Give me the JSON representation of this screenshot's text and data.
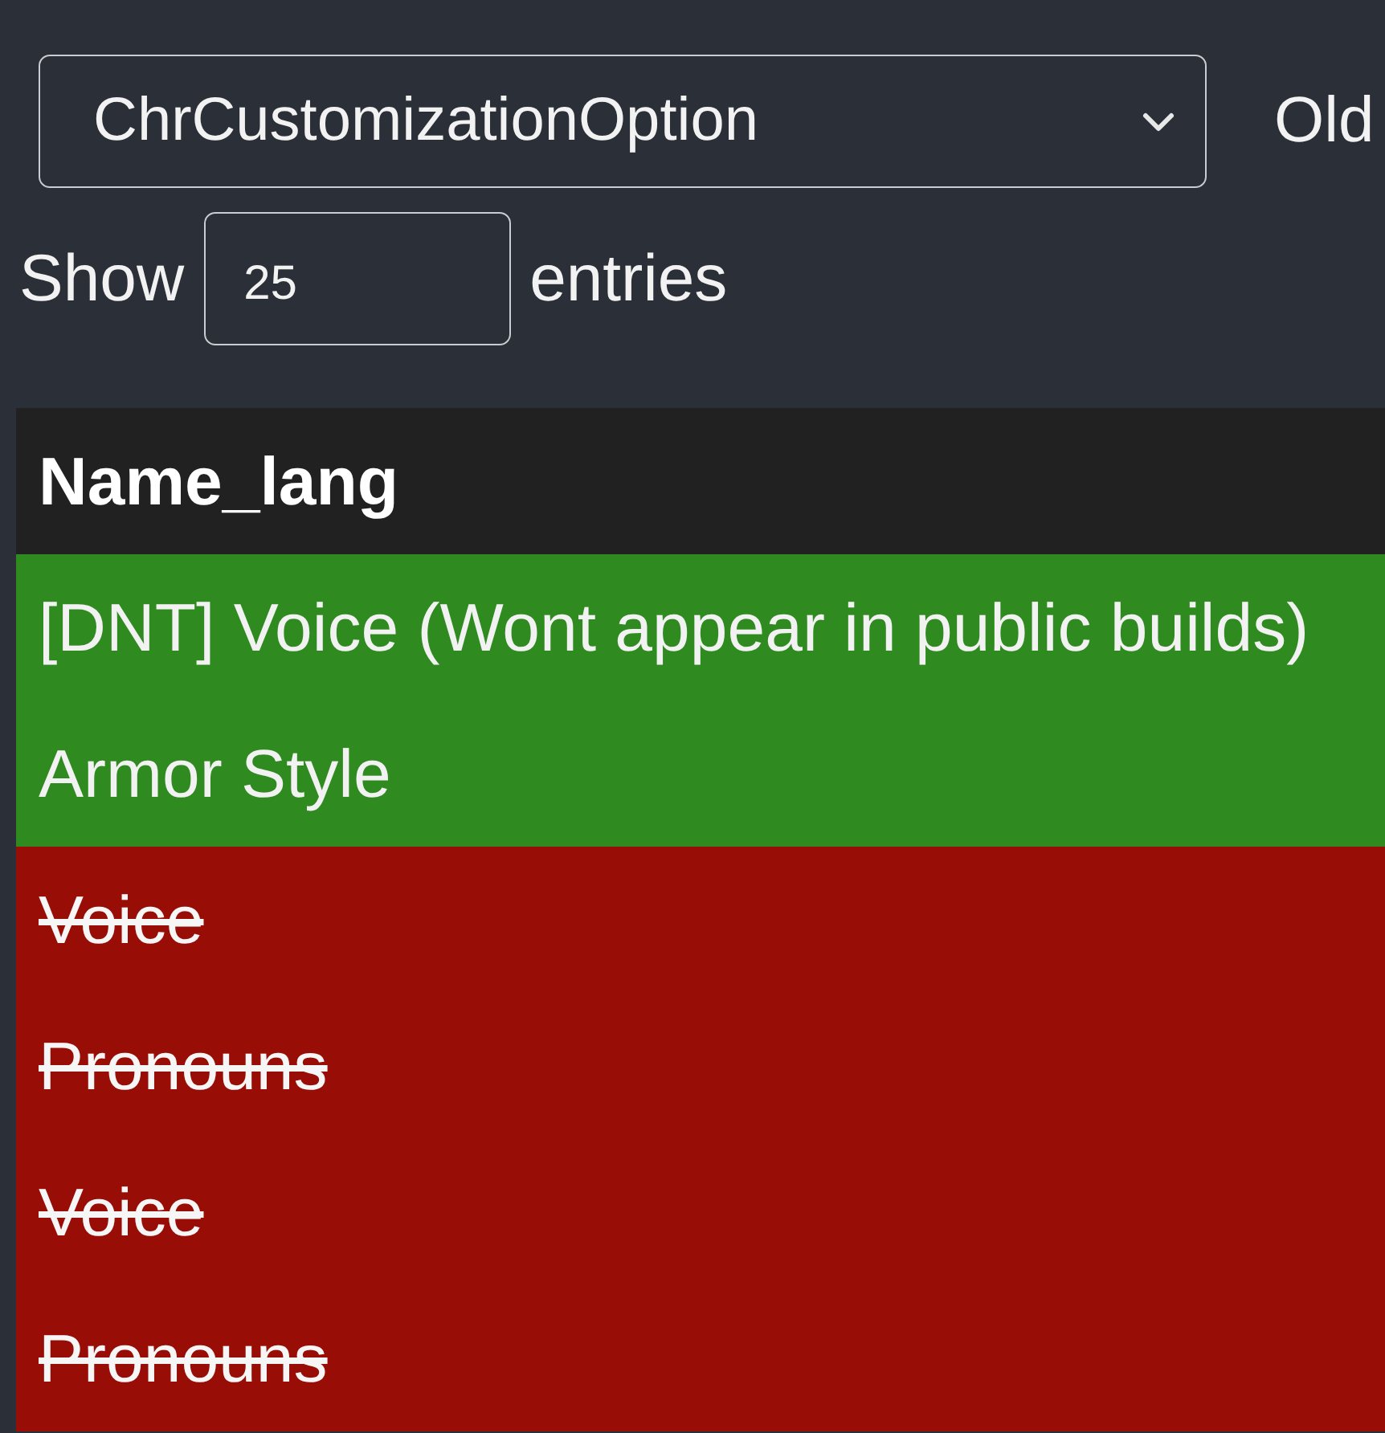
{
  "table_select": {
    "value": "ChrCustomizationOption"
  },
  "compare_label": "Old",
  "page_length": {
    "prefix": "Show",
    "value": "25",
    "suffix": "entries"
  },
  "table": {
    "columns": [
      "Name_lang"
    ],
    "rows": [
      {
        "cells": [
          "[DNT] Voice (Wont appear in public builds)"
        ],
        "kind": "added"
      },
      {
        "cells": [
          "Armor Style"
        ],
        "kind": "added"
      },
      {
        "cells": [
          "Voice"
        ],
        "kind": "removed"
      },
      {
        "cells": [
          "Pronouns"
        ],
        "kind": "removed"
      },
      {
        "cells": [
          "Voice"
        ],
        "kind": "removed"
      },
      {
        "cells": [
          "Pronouns"
        ],
        "kind": "removed"
      }
    ]
  }
}
